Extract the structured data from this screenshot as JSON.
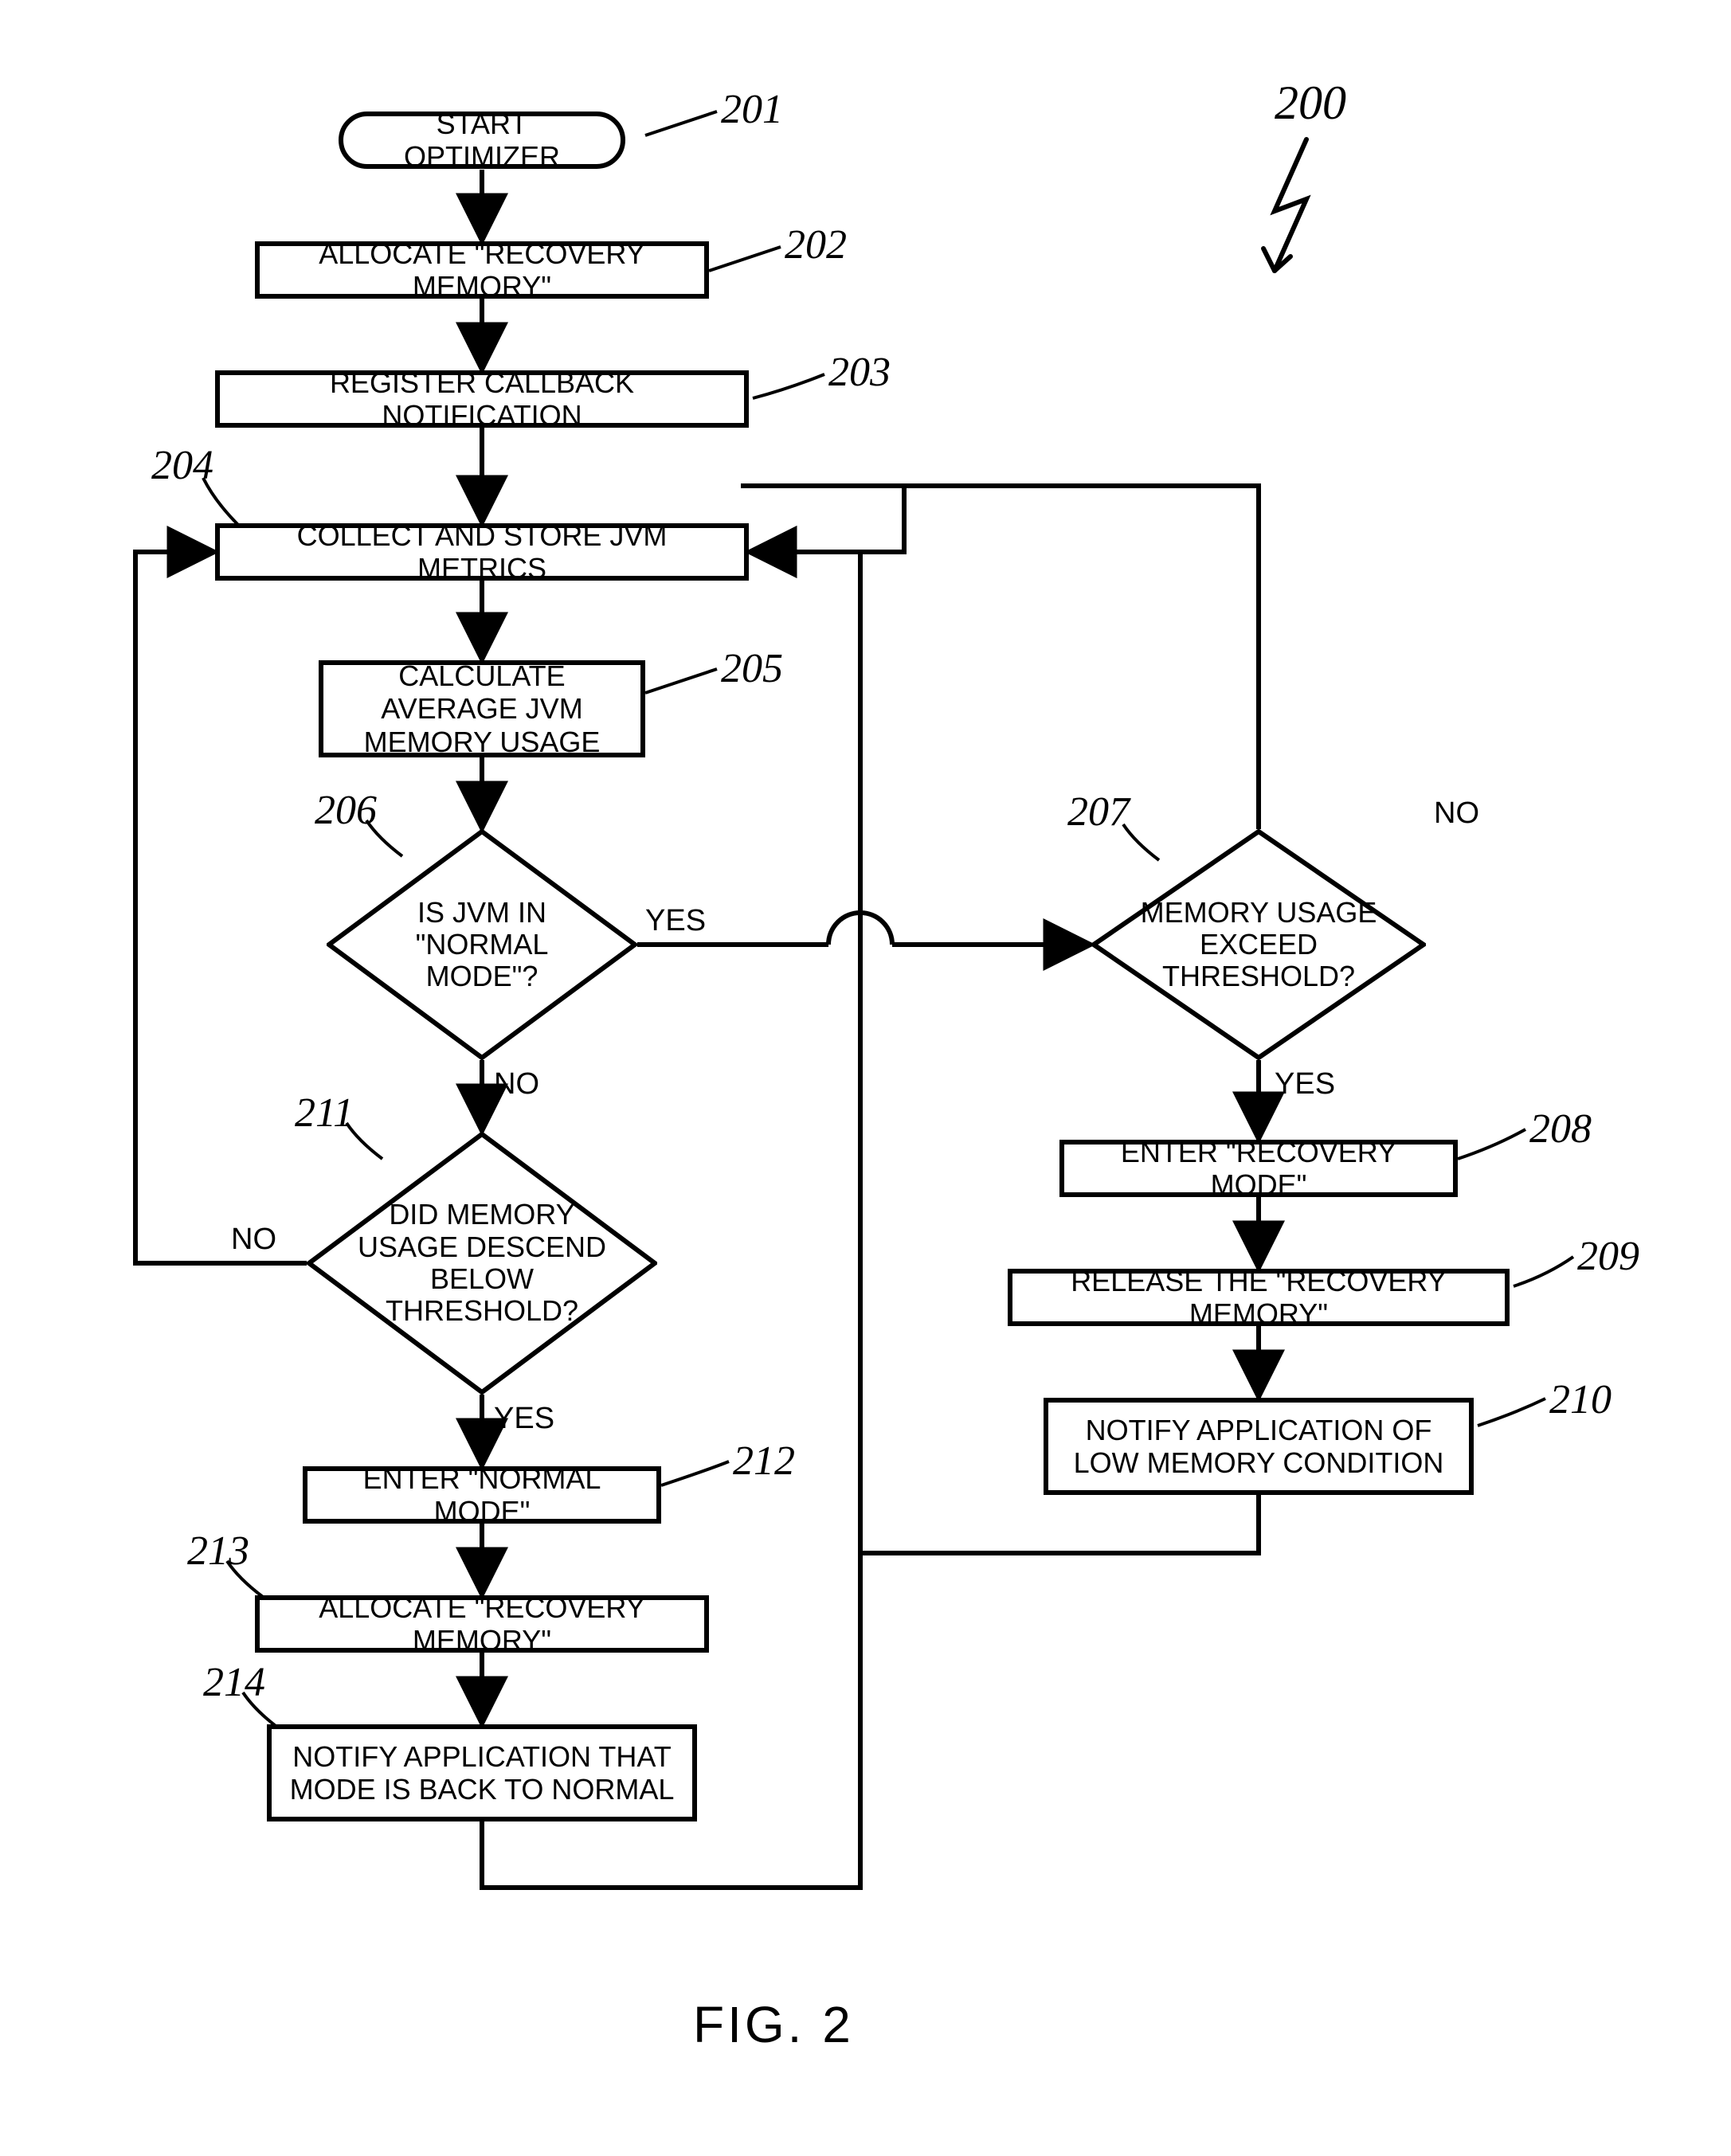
{
  "figure": {
    "ref": "200",
    "caption": "FIG. 2"
  },
  "nodes": {
    "n201": {
      "ref": "201",
      "text": "START OPTIMIZER"
    },
    "n202": {
      "ref": "202",
      "text": "ALLOCATE \"RECOVERY MEMORY\""
    },
    "n203": {
      "ref": "203",
      "text": "REGISTER CALLBACK NOTIFICATION"
    },
    "n204": {
      "ref": "204",
      "text": "COLLECT AND STORE JVM METRICS"
    },
    "n205": {
      "ref": "205",
      "text": "CALCULATE AVERAGE JVM MEMORY USAGE"
    },
    "n206": {
      "ref": "206",
      "text": "IS JVM IN \"NORMAL MODE\"?"
    },
    "n207": {
      "ref": "207",
      "text": "MEMORY USAGE EXCEED THRESHOLD?"
    },
    "n208": {
      "ref": "208",
      "text": "ENTER \"RECOVERY MODE\""
    },
    "n209": {
      "ref": "209",
      "text": "RELEASE THE \"RECOVERY MEMORY\""
    },
    "n210": {
      "ref": "210",
      "text": "NOTIFY APPLICATION OF LOW MEMORY CONDITION"
    },
    "n211": {
      "ref": "211",
      "text": "DID MEMORY USAGE DESCEND BELOW THRESHOLD?"
    },
    "n212": {
      "ref": "212",
      "text": "ENTER \"NORMAL MODE\""
    },
    "n213": {
      "ref": "213",
      "text": "ALLOCATE \"RECOVERY MEMORY\""
    },
    "n214": {
      "ref": "214",
      "text": "NOTIFY APPLICATION THAT MODE IS BACK TO NORMAL"
    }
  },
  "edges": {
    "yes": "YES",
    "no": "NO"
  }
}
